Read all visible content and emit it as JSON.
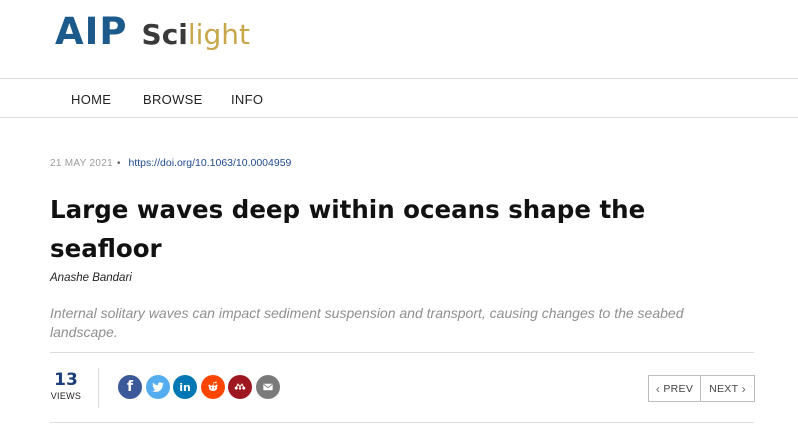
{
  "logo": {
    "brand": "AIP",
    "product_bold": "Sci",
    "product_light": "light"
  },
  "nav": {
    "items": [
      {
        "label": "HOME"
      },
      {
        "label": "BROWSE"
      },
      {
        "label": "INFO"
      }
    ]
  },
  "article": {
    "date": "21 MAY 2021",
    "bullet": "•",
    "doi": "https://doi.org/10.1063/10.0004959",
    "title": "Large waves deep within oceans shape the seafloor",
    "author": "Anashe Bandari",
    "summary": "Internal solitary waves can impact sediment suspension and transport, causing changes to the seabed landscape."
  },
  "stats": {
    "views_count": "13",
    "views_label": "VIEWS"
  },
  "share": [
    {
      "name": "facebook",
      "icon": "facebook-icon",
      "glyph": "f",
      "color": "#3b5998"
    },
    {
      "name": "twitter",
      "icon": "twitter-icon",
      "glyph": "",
      "color": "#55acee"
    },
    {
      "name": "linkedin",
      "icon": "linkedin-icon",
      "glyph": "in",
      "color": "#0077b5"
    },
    {
      "name": "reddit",
      "icon": "reddit-icon",
      "glyph": "",
      "color": "#ff4500"
    },
    {
      "name": "mendeley",
      "icon": "mendeley-icon",
      "glyph": "",
      "color": "#9d1620"
    },
    {
      "name": "email",
      "icon": "envelope-icon",
      "glyph": "",
      "color": "#7a7a7a"
    }
  ],
  "pager": {
    "prev_label": "PREV",
    "next_label": "NEXT",
    "prev_icon": "chevron-left-icon",
    "next_icon": "chevron-right-icon"
  }
}
